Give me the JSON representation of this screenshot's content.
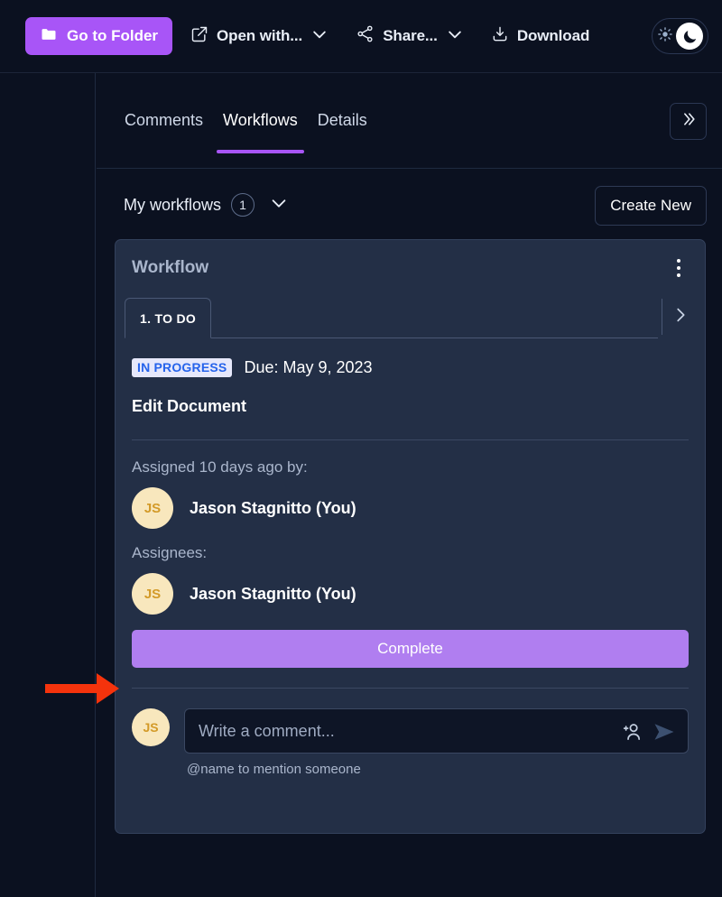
{
  "toolbar": {
    "go_to_folder": "Go to Folder",
    "open_with": "Open with...",
    "share": "Share...",
    "download": "Download",
    "folder_icon": "folder-icon",
    "external_link_icon": "external-link-icon",
    "share_icon": "share-nodes-icon",
    "download_icon": "download-icon",
    "chevron_down_icon": "chevron-down-icon",
    "sun_icon": "sun-icon",
    "moon_icon": "moon-icon",
    "accent_color": "#a855f7"
  },
  "panel": {
    "tabs": [
      {
        "label": "Comments",
        "active": false
      },
      {
        "label": "Workflows",
        "active": true
      },
      {
        "label": "Details",
        "active": false
      }
    ],
    "collapse_icon": "double-chevron-right-icon",
    "active_tab_underline_color": "#a855f7"
  },
  "workflows_header": {
    "title": "My workflows",
    "count": "1",
    "expand_icon": "chevron-down-icon",
    "create_new_label": "Create New"
  },
  "card": {
    "title": "Workflow",
    "menu_icon": "kebab-menu-icon",
    "step_tabs": [
      {
        "label": "1. TO DO",
        "active": true
      }
    ],
    "next_step_icon": "chevron-right-icon",
    "status_badge": "IN PROGRESS",
    "status_badge_text_color": "#2563eb",
    "status_badge_bg_color": "#e6e8fb",
    "due_text": "Due: May 9, 2023",
    "task_name": "Edit Document",
    "assigned_by_label": "Assigned 10 days ago by:",
    "assigned_by": {
      "initials": "JS",
      "name": "Jason Stagnitto (You)"
    },
    "assignees_label": "Assignees:",
    "assignees": [
      {
        "initials": "JS",
        "name": "Jason Stagnitto (You)"
      }
    ],
    "complete_label": "Complete",
    "complete_color": "#b07ef0",
    "avatar_bg_color": "#f8e7bd",
    "avatar_text_color": "#d39a28"
  },
  "comment": {
    "avatar_initials": "JS",
    "placeholder": "Write a comment...",
    "value": "",
    "mention_icon": "add-person-icon",
    "send_icon": "send-icon",
    "hint": "@name to mention someone"
  },
  "annotation": {
    "arrow_color": "#f5330c",
    "arrow_name": "red-arrow-pointing-to-complete-button"
  }
}
